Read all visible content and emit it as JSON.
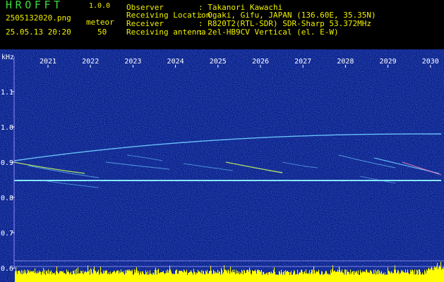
{
  "header": {
    "app_title": "HROFFT",
    "app_version": "1.0.0",
    "file_name": "2505132020.png",
    "date_time": "25.05.13 20:20",
    "meteor_label": "meteor",
    "meteor_count": "50",
    "info": [
      {
        "label": "Observer",
        "value": ": Takanori Kawachi"
      },
      {
        "label": "Receiving Location",
        "value": ": Ogaki, Gifu, JAPAN (136.60E, 35.35N)"
      },
      {
        "label": "Receiver",
        "value": ": R820T2(RTL-SDR) SDR-Sharp 53.372MHz"
      },
      {
        "label": "Receiving antenna",
        "value": ": 2el-HB9CV Vertical (el. E-W)"
      }
    ]
  },
  "spectrogram": {
    "y_unit": "kHz",
    "y_ticks": [
      "1.1",
      "1.0",
      "0.9",
      "0.8",
      "0.7",
      "0.6"
    ],
    "x_ticks": [
      "2021",
      "2022",
      "2023",
      "2024",
      "2025",
      "2026",
      "2027",
      "2028",
      "2029",
      "2030"
    ],
    "colors": {
      "background": "#0a1a7a",
      "axis_text": "#ffffff",
      "signal": "#6ec8ff",
      "activity_bar": "#ffff00"
    }
  }
}
